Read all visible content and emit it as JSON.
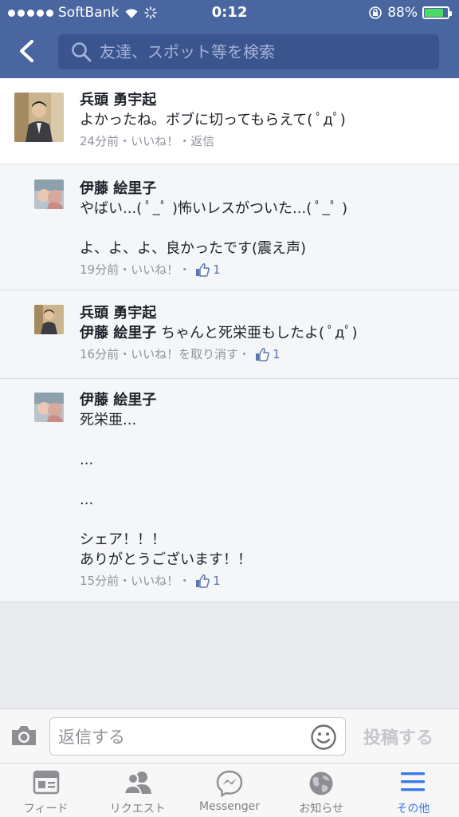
{
  "status_bar": {
    "carrier": "SoftBank",
    "time": "0:12",
    "battery_percent": "88%",
    "battery_level": 0.88
  },
  "nav": {
    "search_placeholder": "友達、スポット等を検索"
  },
  "comments": [
    {
      "author": "兵頭 勇宇起",
      "text": "よかったね。ボブに切ってもらえて( ﾟдﾟ)",
      "time": "24分前",
      "like_label": "いいね！",
      "reply_label": "返信"
    },
    {
      "author": "伊藤 絵里子",
      "text": "やばい...( ﾟ_ﾟ )怖いレスがついた...( ﾟ_ﾟ )\n\nよ、よ、よ、良かったです(震え声)",
      "time": "19分前",
      "like_label": "いいね！",
      "like_count": "1"
    },
    {
      "author": "兵頭 勇宇起",
      "mention": "伊藤 絵里子",
      "text": " ちゃんと死栄亜もしたよ( ﾟдﾟ)",
      "time": "16分前",
      "like_label": "いいね！を取り消す",
      "like_count": "1"
    },
    {
      "author": "伊藤 絵里子",
      "text": "死栄亜...\n\n...\n\n...\n\nシェア！！！\nありがとうございます！！",
      "time": "15分前",
      "like_label": "いいね！",
      "like_count": "1"
    }
  ],
  "composer": {
    "placeholder": "返信する",
    "post_label": "投稿する"
  },
  "tabbar": {
    "items": [
      {
        "label": "フィード",
        "icon": "feed-icon"
      },
      {
        "label": "リクエスト",
        "icon": "friend-requests-icon"
      },
      {
        "label": "Messenger",
        "icon": "messenger-icon"
      },
      {
        "label": "お知らせ",
        "icon": "globe-notifications-icon"
      },
      {
        "label": "その他",
        "icon": "menu-icon",
        "active": true
      }
    ]
  },
  "colors": {
    "nav_blue": "#4a66a0",
    "search_bg": "#3a548e",
    "active_tab": "#3b78e7",
    "like_blue": "#5b76ad"
  }
}
